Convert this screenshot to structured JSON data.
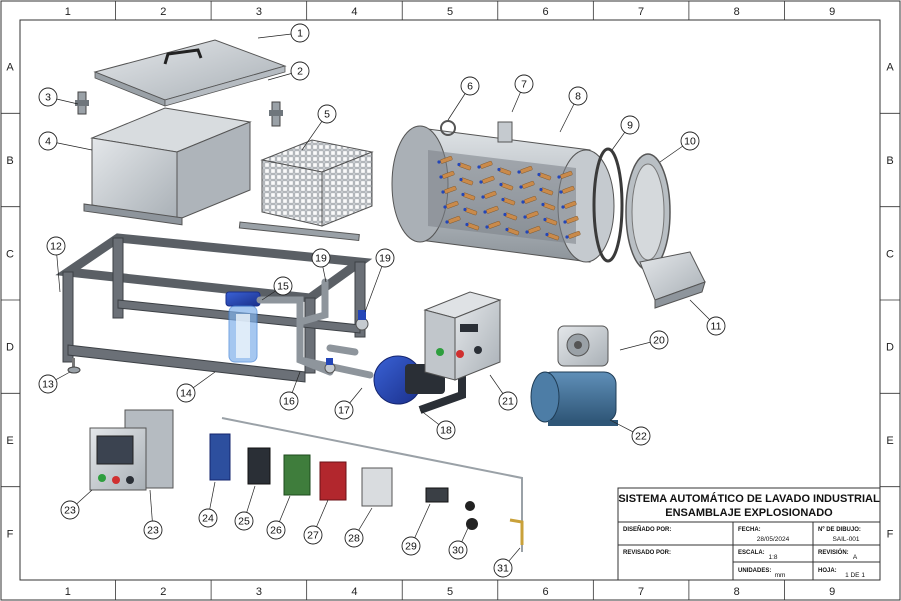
{
  "zones": {
    "columns": [
      "1",
      "2",
      "3",
      "4",
      "5",
      "6",
      "7",
      "8",
      "9"
    ],
    "rows": [
      "A",
      "B",
      "C",
      "D",
      "E",
      "F"
    ]
  },
  "callouts": [
    "1",
    "2",
    "3",
    "4",
    "5",
    "6",
    "7",
    "8",
    "9",
    "10",
    "11",
    "12",
    "13",
    "14",
    "15",
    "16",
    "17",
    "18",
    "19",
    "19",
    "20",
    "21",
    "22",
    "23",
    "23",
    "24",
    "25",
    "26",
    "27",
    "28",
    "29",
    "30",
    "31"
  ],
  "title_block": {
    "title_line1": "SISTEMA AUTOMÁTICO DE LAVADO INDUSTRIAL",
    "title_line2": "ENSAMBLAJE EXPLOSIONADO",
    "designed_by_label": "DISEÑADO POR:",
    "date_label": "FECHA:",
    "date_value": "28/05/2024",
    "drawing_no_label": "Nº DE DIBUJO:",
    "drawing_no_value": "SAIL-001",
    "reviewed_by_label": "REVISADO POR:",
    "scale_label": "ESCALA:",
    "scale_value": "1:8",
    "revision_label": "REVISIÓN:",
    "revision_value": "A",
    "units_label": "UNIDADES:",
    "units_value": "mm",
    "sheet_label": "HOJA:",
    "sheet_value": "1 DE 1"
  },
  "colors": {
    "steel": "#c7ccd1",
    "steel_dark": "#8e959c",
    "frame": "#6b7077",
    "pump_blue": "#2446b8",
    "motor_blue": "#3f6f9a",
    "filter_blue": "#3d7fd6",
    "nozzle_orange": "#c98a4b",
    "led_green": "#2e9e3e",
    "led_red": "#d03030"
  }
}
